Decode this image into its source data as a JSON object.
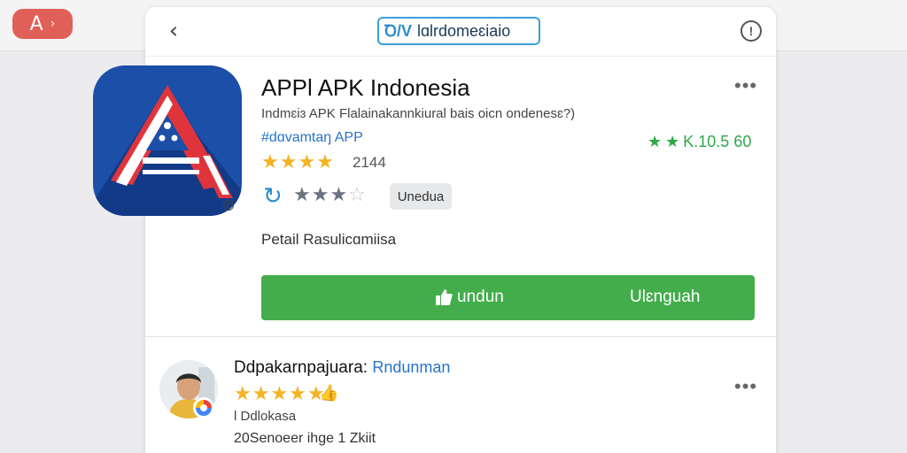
{
  "corner_badge": {
    "label": "A",
    "arrow": "›"
  },
  "topbar": {
    "back": "‹",
    "url_icon": "Ꝺ/V",
    "url_text": "lɑlrdomeɛiaio",
    "info": "!"
  },
  "app": {
    "title": "APPl APK Indonesia",
    "subtitle": "Indmɛiɜ APK Flalainakannkiural bais oicn ondenesɛ?)",
    "tag": "#dɑvamtaŋ APP",
    "rating_right": "K.10.5 60",
    "stars_rating": "★★★★",
    "rating_count": "2144",
    "stars_2_on": "★★★",
    "stars_2_off": "☆",
    "chip": "Unedua",
    "detail": "Petail Rasulicɑmiisa",
    "download_left": "undun",
    "download_right": "Ulɛnguah",
    "colors": {
      "accent_green": "#43ad4b",
      "link_blue": "#2874c8",
      "star_gold": "#f4b323",
      "icon_bg": "#1b4fa8",
      "icon_red": "#e0343c"
    }
  },
  "review": {
    "name": "Ddpakarnpajuara:",
    "name_tag": "Rndunman",
    "stars": "★★★★★",
    "subtitle": "l Ddlokasa",
    "date": "20Senoeer ihge 1 Zkiit"
  }
}
